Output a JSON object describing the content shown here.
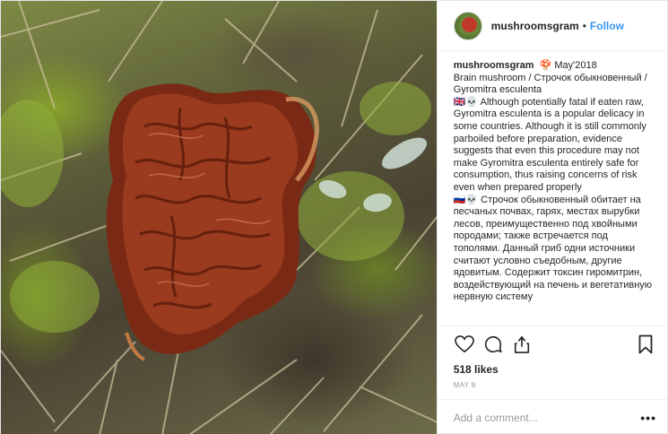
{
  "post": {
    "username": "mushroomsgram",
    "follow_label": "Follow",
    "dot": "•",
    "photo_alt": "",
    "caption": {
      "username": "mushroomsgram",
      "lines": [
        "🍄 May'2018",
        "Brain mushroom / Строчок обыкновенный / Gyromitra esculenta",
        "🇬🇧💀 Although potentially fatal if eaten raw, Gyromitra esculenta is a popular delicacy in some countries. Although it is still commonly parboiled before preparation, evidence suggests that even this procedure may not make Gyromitra esculenta entirely safe for consumption, thus raising concerns of risk even when prepared properly",
        "🇷🇺💀 Строчок обыкновенный обитает на песчаных почвах, гарях, местах вырубки лесов, преимущественно под хвойными породами; также встречается под тополями. Данный гриб одни источники считают условно съедобным, другие ядовитым. Содержит токсин гиромитрин, воздействующий на печень и вегетативную нервную систему"
      ]
    },
    "likes": "518 likes",
    "date": "MAY 8",
    "add_comment_placeholder": "Add a comment...",
    "more_options": "•••",
    "icons": {
      "like": "heart-icon",
      "comment": "comment-icon",
      "share": "share-icon",
      "save": "bookmark-icon"
    },
    "colors": {
      "follow": "#3897f0",
      "text": "#262626",
      "muted": "#999999"
    }
  }
}
